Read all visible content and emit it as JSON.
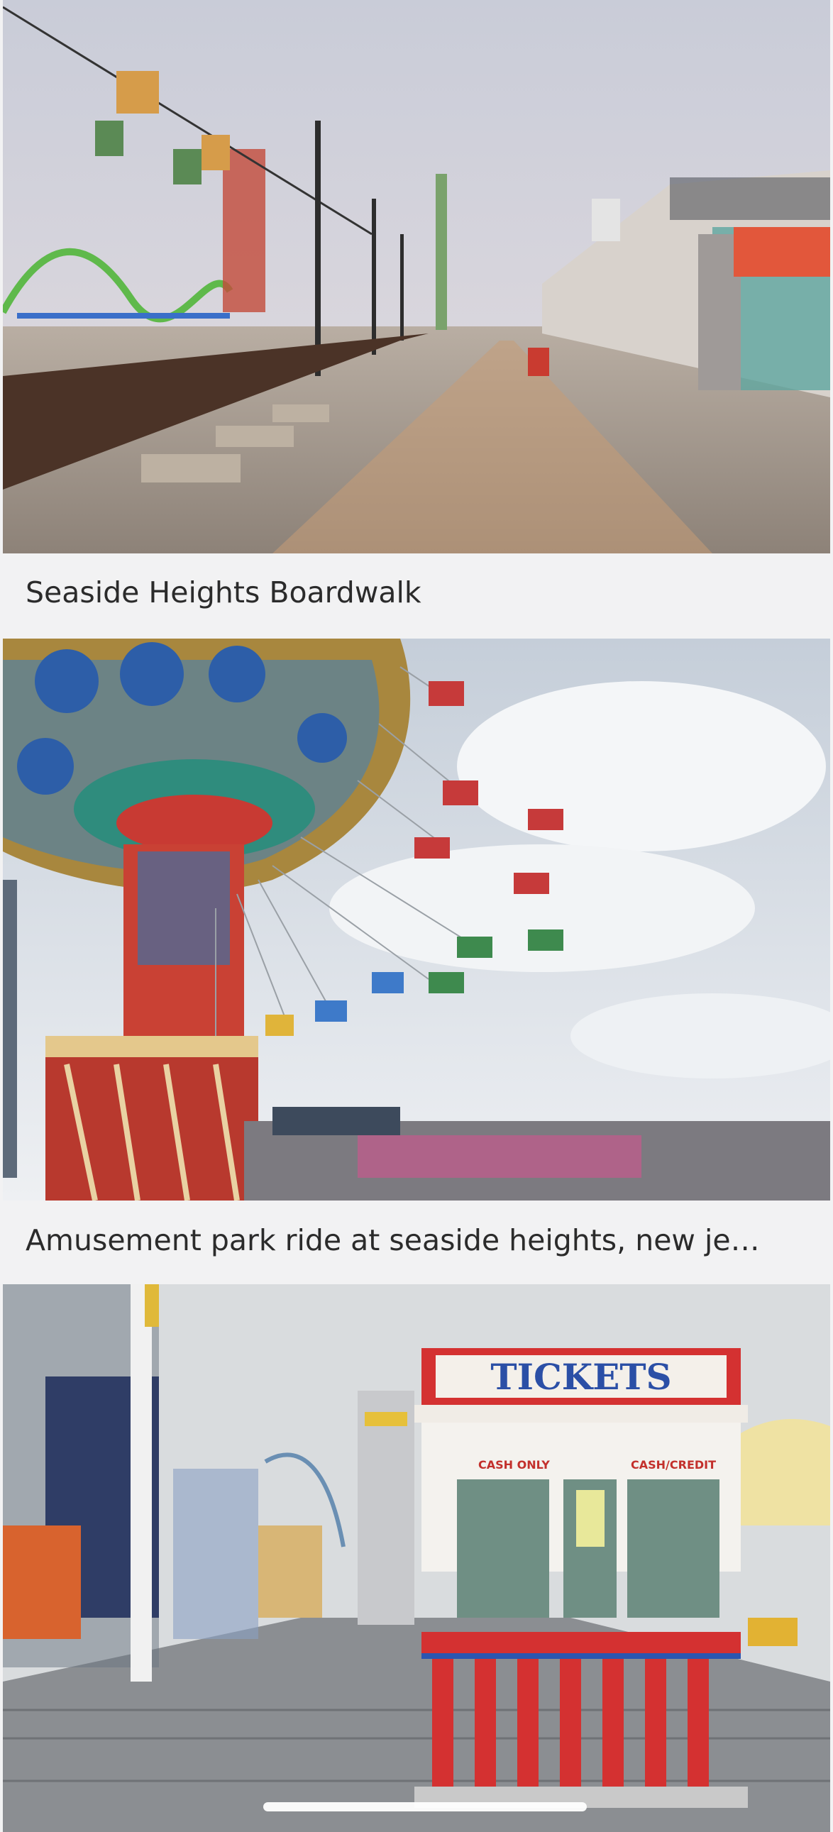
{
  "feed": {
    "items": [
      {
        "caption": "Seaside Heights Boardwalk",
        "image_icon": "boardwalk-photo"
      },
      {
        "caption": "Amusement park ride at seaside heights, new je…",
        "image_icon": "swing-ride-photo"
      },
      {
        "caption": "",
        "image_icon": "ticket-booth-photo",
        "booth_sign": "TICKETS",
        "booth_left_label": "CASH ONLY",
        "booth_right_label": "CASH/CREDIT"
      }
    ]
  }
}
